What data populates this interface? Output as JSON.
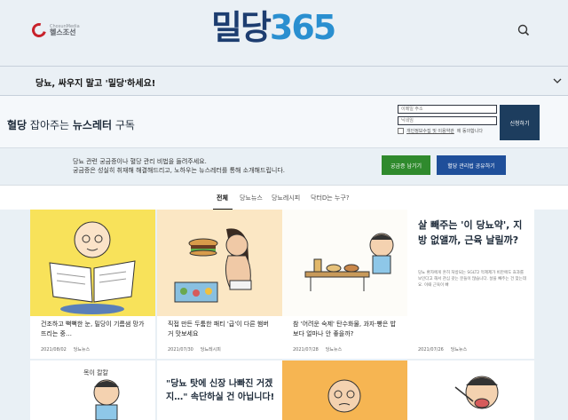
{
  "header": {
    "brand_small": "ChosunMedia",
    "brand_name": "헬스조선",
    "logo_part1": "밀당",
    "logo_part2": "365",
    "search_icon": "search-icon"
  },
  "banner": {
    "text": "당뇨, 싸우지 말고 '밀당'하세요!",
    "chevron_icon": "chevron-down-icon"
  },
  "newsletter": {
    "title_bold1": "혈당",
    "title_mid": " 잡아주는 ",
    "title_bold2": "뉴스레터",
    "title_end": " 구독",
    "email_placeholder": "이메일 주소",
    "nickname_placeholder": "닉네임",
    "agree_label": "개인정보수집 및 이용약관",
    "agree_suffix": "에 동의합니다",
    "subscribe_label": "신청하기"
  },
  "intro": {
    "line1": "당뇨 관련 궁금증이나 혈당 관리 비법을 들려주세요.",
    "line2": "궁금증은 성실히 취재해 해결해드리고, 노하우는 뉴스레터를 통해 소개해드립니다.",
    "question_button": "궁금증 남기기",
    "share_button": "혈당 관리법 공유하기"
  },
  "tabs": [
    {
      "label": "전체",
      "active": true
    },
    {
      "label": "당뇨뉴스",
      "active": false
    },
    {
      "label": "당뇨레시피",
      "active": false
    },
    {
      "label": "닥터D는 누구?",
      "active": false
    }
  ],
  "cards": [
    {
      "title": "건조하고 뻑뻑한 눈, 밀당이 기름샘 망가뜨리는 중…",
      "date": "2021/08/02",
      "category": "당뇨뉴스"
    },
    {
      "title": "직접 만든 두툼한 패티 '급'이 다른 햄버거 맛보세요",
      "date": "2021/07/30",
      "category": "당뇨레시피"
    },
    {
      "title": "참 '어려운 숙제' 탄수화물, 과자·빵은 밥보다 얼마나 안 좋을까?",
      "date": "2021/07/28",
      "category": "당뇨뉴스"
    },
    {
      "title": "살 빼주는 '이 당뇨약', 지방 없앨까, 근육 날릴까?",
      "body": "당뇨 환자에게 흔히 처방되는 SGLT2 억제제가 비만에도 효과를 보인다고 해서 관심 갖는 분들이 많습니다. 살을 빼주는 건 맞는데요. 이때 근육이 빠",
      "date": "2021/07/26",
      "category": "당뇨뉴스"
    }
  ],
  "cards_row2": [
    {
      "cartoon_text": "목이 칼칼"
    },
    {
      "title": "\"당뇨 탓에 신장 나빠진 거겠지…\" 속단하실 건 아닙니다!"
    }
  ],
  "colors": {
    "logo_navy": "#1d3d70",
    "logo_blue": "#2a8fd0",
    "subscribe_navy": "#1d3d5e",
    "green": "#2f8a2d",
    "blue": "#1f4f9a",
    "yellow": "#f8e25a",
    "peach": "#fbe7c4",
    "orange": "#f6b552"
  }
}
